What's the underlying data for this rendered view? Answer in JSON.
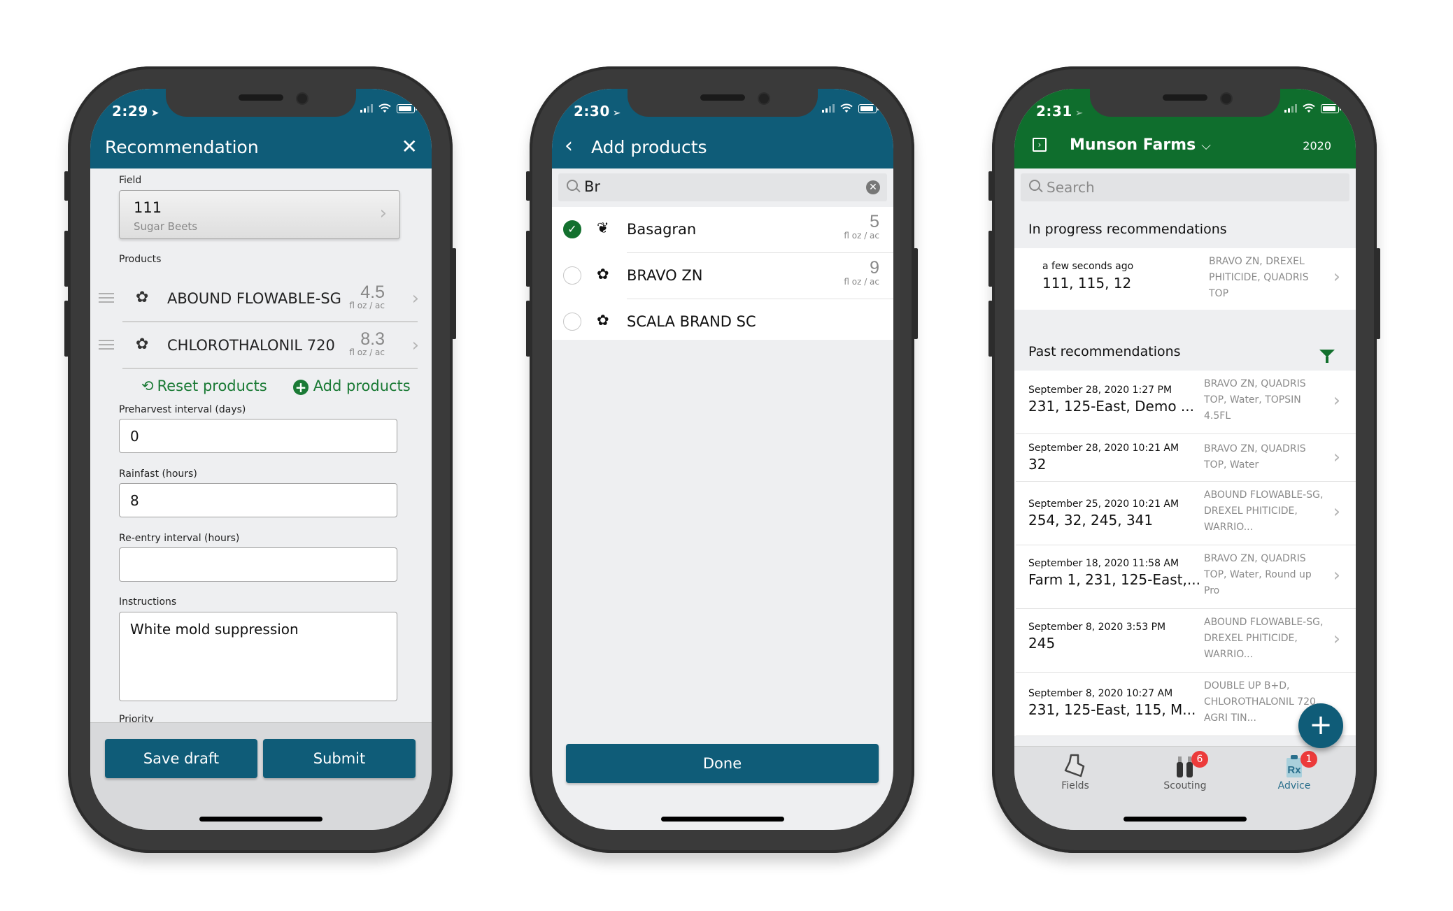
{
  "colors": {
    "teal_primary": "#0f5c78",
    "farm_green": "#0f6e2d",
    "action_green": "#1a7a35",
    "badge_red": "#ec3b3b",
    "screen_bg": "#eeeff1"
  },
  "phone1": {
    "status": {
      "time": "2:29",
      "location_icon": "location-arrow-icon"
    },
    "header": {
      "title": "Recommendation",
      "close_icon": "✕"
    },
    "field": {
      "label": "Field",
      "value": "111",
      "subtitle": "Sugar Beets"
    },
    "products": {
      "label": "Products",
      "items": [
        {
          "name": "ABOUND FLOWABLE-SG",
          "amount": "4.5",
          "unit": "fl oz / ac",
          "icon": "fungicide-icon"
        },
        {
          "name": "CHLOROTHALONIL 720",
          "amount": "8.3",
          "unit": "fl oz / ac",
          "icon": "fungicide-icon"
        }
      ],
      "reset_label": "Reset products",
      "add_label": "Add products"
    },
    "preharvest": {
      "label": "Preharvest interval (days)",
      "value": "0"
    },
    "rainfast": {
      "label": "Rainfast (hours)",
      "value": "8"
    },
    "reentry": {
      "label": "Re-entry interval (hours)",
      "value": ""
    },
    "instructions": {
      "label": "Instructions",
      "value": "White mold suppression"
    },
    "priority": {
      "label": "Priority"
    },
    "buttons": {
      "save_draft": "Save draft",
      "submit": "Submit"
    }
  },
  "phone2": {
    "status": {
      "time": "2:30"
    },
    "header": {
      "title": "Add products",
      "back_icon": "‹"
    },
    "search": {
      "value": "Br"
    },
    "items": [
      {
        "name": "Basagran",
        "amount": "5",
        "unit": "fl oz / ac",
        "selected": true,
        "icon": "herbicide-sprout-icon"
      },
      {
        "name": "BRAVO ZN",
        "amount": "9",
        "unit": "fl oz / ac",
        "selected": false,
        "icon": "fungicide-icon"
      },
      {
        "name": "SCALA BRAND SC",
        "amount": "",
        "unit": "",
        "selected": false,
        "icon": "fungicide-icon"
      }
    ],
    "done_label": "Done"
  },
  "phone3": {
    "status": {
      "time": "2:31"
    },
    "header": {
      "farm": "Munson Farms",
      "year": "2020"
    },
    "search": {
      "placeholder": "Search"
    },
    "in_progress": {
      "title": "In progress recommendations",
      "items": [
        {
          "when": "a few seconds ago",
          "fields": "111, 115, 12",
          "products": "BRAVO ZN, DREXEL PHITICIDE, QUADRIS TOP"
        }
      ]
    },
    "past": {
      "title": "Past recommendations",
      "items": [
        {
          "when": "September 28, 2020 1:27 PM",
          "fields": "231, 125-East, Demo ...",
          "products": "BRAVO ZN, QUADRIS TOP, Water, TOPSIN 4.5FL"
        },
        {
          "when": "September 28, 2020 10:21 AM",
          "fields": "32",
          "products": "BRAVO ZN, QUADRIS TOP, Water"
        },
        {
          "when": "September 25, 2020 10:21 AM",
          "fields": "254, 32, 245, 341",
          "products": "ABOUND FLOWABLE-SG, DREXEL PHITICIDE, WARRIO..."
        },
        {
          "when": "September 18, 2020 11:58 AM",
          "fields": "Farm 1, 231, 125-East,...",
          "products": "BRAVO ZN, QUADRIS TOP, Water, Round up Pro"
        },
        {
          "when": "September 8, 2020 3:53 PM",
          "fields": "245",
          "products": "ABOUND FLOWABLE-SG, DREXEL PHITICIDE, WARRIO..."
        },
        {
          "when": "September 8, 2020 10:27 AM",
          "fields": "231, 125-East, 115, M...",
          "products": "DOUBLE UP B+D, CHLOROTHALONIL 720, AGRI TIN..."
        }
      ]
    },
    "tabs": [
      {
        "label": "Fields",
        "badge": ""
      },
      {
        "label": "Scouting",
        "badge": "6"
      },
      {
        "label": "Advice",
        "badge": "1",
        "active": true
      }
    ]
  }
}
